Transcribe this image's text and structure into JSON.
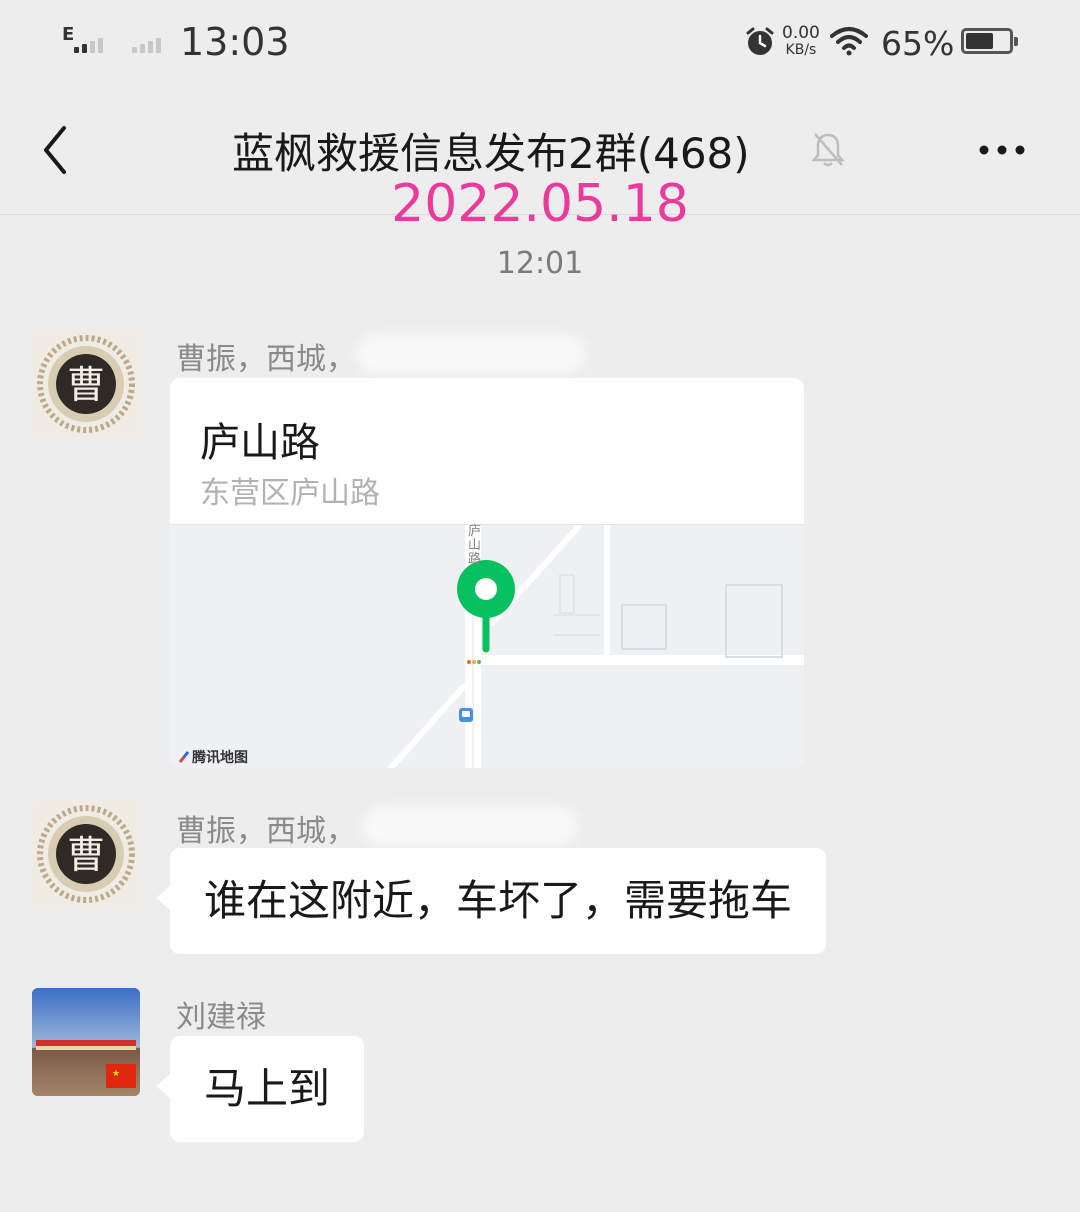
{
  "status_bar": {
    "network_label": "E",
    "time": "13:03",
    "net_speed_value": "0.00",
    "net_speed_unit": "KB/s",
    "battery_percent": "65%",
    "battery_level": 0.65
  },
  "header": {
    "title": "蓝枫救援信息发布2群(468)",
    "muted": true
  },
  "overlay_date": "2022.05.18",
  "timestamp": "12:01",
  "colors": {
    "background": "#ededed",
    "bubble": "#ffffff",
    "date_overlay": "#ea3a9c",
    "map_pin": "#07c160"
  },
  "messages": [
    {
      "sender": "曹振，西城，",
      "avatar_char": "曹",
      "type": "location",
      "location": {
        "name": "庐山路",
        "address": "东营区庐山路",
        "map_road_label": "庐山路",
        "map_brand": "腾讯地图"
      }
    },
    {
      "sender": "曹振，西城，",
      "avatar_char": "曹",
      "type": "text",
      "text": "谁在这附近，车坏了，需要拖车"
    },
    {
      "sender": "刘建禄",
      "type": "text",
      "text": "马上到"
    }
  ]
}
